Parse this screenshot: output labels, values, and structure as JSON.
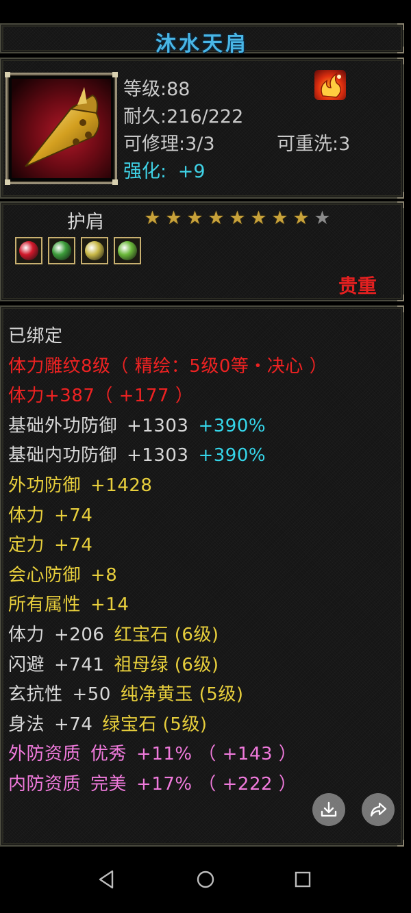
{
  "item": {
    "name": "沐水天肩",
    "level": "等级:88",
    "durability": "耐久:216/222",
    "repairable": "可修理:3/3",
    "rewash": "可重洗:3",
    "enhance_label": "强化:",
    "enhance_value": "+9",
    "type": "护肩",
    "stars_on": 8,
    "stars_total": 9,
    "grade": "贵重",
    "gems": [
      {
        "name": "red-gem",
        "color": "#d0182a"
      },
      {
        "name": "green-gem",
        "color": "#3c9c3a"
      },
      {
        "name": "yellow-gem",
        "color": "#c8b848"
      },
      {
        "name": "jade-gem",
        "color": "#6ab83a"
      }
    ]
  },
  "colors": {
    "white": "#d8d8d8",
    "red": "#ee2222",
    "yellow": "#e8cf3c",
    "cyan": "#35d6ea",
    "pink": "#f07adc",
    "star_on": "#c8a23a",
    "star_off": "#8a8a8a"
  },
  "attributes": [
    {
      "label": "已绑定",
      "value": "",
      "extra": "",
      "color": "white"
    },
    {
      "label": "体力雕纹8级（ 精绘：5级0等・决心 ）",
      "value": "",
      "extra": "",
      "color": "red"
    },
    {
      "label": "体力+387（ +177 ）",
      "value": "",
      "extra": "",
      "color": "red"
    },
    {
      "label": "基础外功防御",
      "value": "+1303",
      "extra": "+390%",
      "color": "white",
      "extra_color": "cyan"
    },
    {
      "label": "基础内功防御",
      "value": "+1303",
      "extra": "+390%",
      "color": "white",
      "extra_color": "cyan"
    },
    {
      "label": "外功防御",
      "value": "+1428",
      "extra": "",
      "color": "yellow"
    },
    {
      "label": "体力",
      "value": "+74",
      "extra": "",
      "color": "yellow"
    },
    {
      "label": "定力",
      "value": "+74",
      "extra": "",
      "color": "yellow"
    },
    {
      "label": "会心防御",
      "value": "+8",
      "extra": "",
      "color": "yellow"
    },
    {
      "label": "所有属性",
      "value": "+14",
      "extra": "",
      "color": "yellow"
    },
    {
      "label": "体力",
      "value": "+206",
      "extra": "红宝石 (6级)",
      "color": "white",
      "extra_color": "yellow"
    },
    {
      "label": "闪避",
      "value": "+741",
      "extra": "祖母绿 (6级)",
      "color": "white",
      "extra_color": "yellow"
    },
    {
      "label": "玄抗性",
      "value": "+50",
      "extra": "纯净黄玉 (5级)",
      "color": "white",
      "extra_color": "yellow"
    },
    {
      "label": "身法",
      "value": "+74",
      "extra": "绿宝石 (5级)",
      "color": "white",
      "extra_color": "yellow"
    },
    {
      "label": "外防资质",
      "value": "优秀",
      "extra": "+11% （ +143 ）",
      "color": "pink",
      "extra_color": "pink"
    },
    {
      "label": "内防资质",
      "value": "完美",
      "extra": "+17% （ +222 ）",
      "color": "pink",
      "extra_color": "pink"
    }
  ],
  "actions": {
    "download_icon": "download-icon",
    "share_icon": "share-icon"
  },
  "nav": [
    "back-icon",
    "home-icon",
    "recents-icon"
  ]
}
